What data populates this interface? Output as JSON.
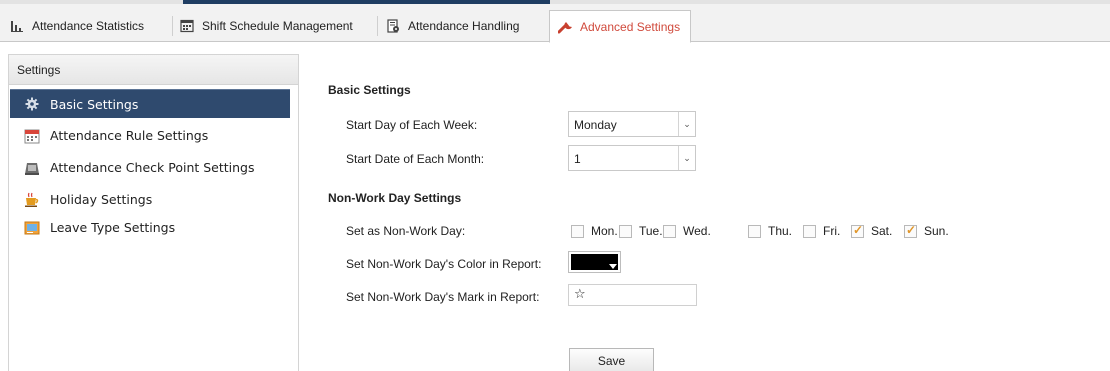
{
  "tabs": [
    {
      "label": "Attendance Statistics",
      "icon": "bar-chart-icon",
      "active": false
    },
    {
      "label": "Shift Schedule Management",
      "icon": "calendar-grid-icon",
      "active": false
    },
    {
      "label": "Attendance Handling",
      "icon": "document-gear-icon",
      "active": false
    },
    {
      "label": "Advanced Settings",
      "icon": "wrench-icon",
      "active": true
    }
  ],
  "sidebar": {
    "header": "Settings",
    "items": [
      {
        "label": "Basic Settings",
        "icon": "gear-icon",
        "active": true
      },
      {
        "label": "Attendance Rule Settings",
        "icon": "calendar-icon",
        "active": false
      },
      {
        "label": "Attendance Check Point Settings",
        "icon": "checkpoint-device-icon",
        "active": false
      },
      {
        "label": "Holiday Settings",
        "icon": "coffee-cup-icon",
        "active": false
      },
      {
        "label": "Leave Type Settings",
        "icon": "leave-form-icon",
        "active": false
      }
    ]
  },
  "basic": {
    "title": "Basic Settings",
    "start_day_label": "Start Day of Each Week:",
    "start_day_value": "Monday",
    "start_date_label": "Start Date of Each Month:",
    "start_date_value": "1"
  },
  "nonwork": {
    "title": "Non-Work Day Settings",
    "set_label": "Set as Non-Work Day:",
    "days": [
      {
        "label": "Mon.",
        "checked": false
      },
      {
        "label": "Tue.",
        "checked": false
      },
      {
        "label": "Wed.",
        "checked": false
      },
      {
        "label": "Thu.",
        "checked": false
      },
      {
        "label": "Fri.",
        "checked": false
      },
      {
        "label": "Sat.",
        "checked": true
      },
      {
        "label": "Sun.",
        "checked": true
      }
    ],
    "color_label": "Set Non-Work Day's Color in Report:",
    "color_value": "#000000",
    "mark_label": "Set Non-Work Day's Mark in Report:",
    "mark_value": "☆"
  },
  "actions": {
    "save_label": "Save"
  },
  "colors": {
    "accent_red": "#d04a3c",
    "sidebar_active": "#2f4a6e",
    "checkmark": "#e0962a",
    "tab_accent": "#1f3d62"
  }
}
